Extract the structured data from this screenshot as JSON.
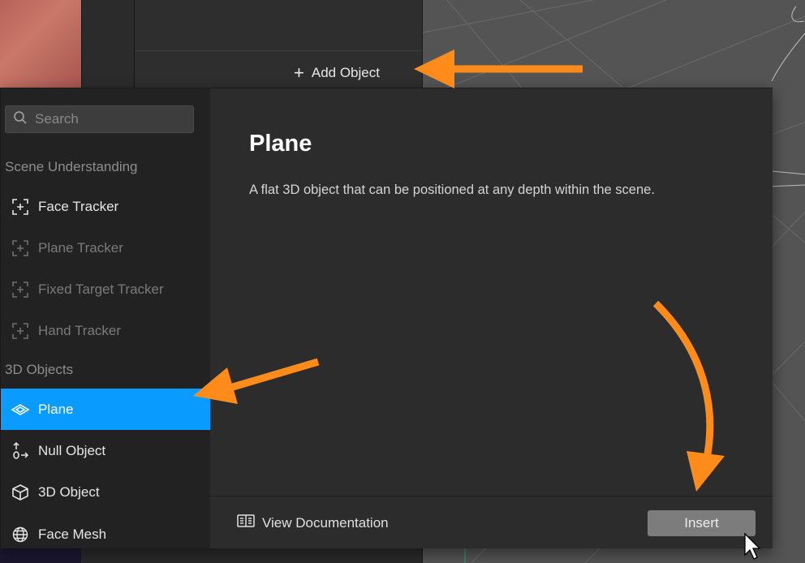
{
  "toolbar": {
    "add_object_label": "Add Object"
  },
  "dialog": {
    "search": {
      "placeholder": "Search"
    },
    "sections": [
      {
        "title": "Scene Understanding",
        "items": [
          {
            "label": "Face Tracker",
            "icon": "face-tracker-icon",
            "enabled": true
          },
          {
            "label": "Plane Tracker",
            "icon": "plane-tracker-icon",
            "enabled": false
          },
          {
            "label": "Fixed Target Tracker",
            "icon": "fixed-target-tracker-icon",
            "enabled": false
          },
          {
            "label": "Hand Tracker",
            "icon": "hand-tracker-icon",
            "enabled": false
          }
        ]
      },
      {
        "title": "3D Objects",
        "items": [
          {
            "label": "Plane",
            "icon": "plane-icon",
            "selected": true
          },
          {
            "label": "Null Object",
            "icon": "null-object-icon"
          },
          {
            "label": "3D Object",
            "icon": "cube-icon"
          },
          {
            "label": "Face Mesh",
            "icon": "face-mesh-icon"
          }
        ]
      }
    ],
    "detail": {
      "title": "Plane",
      "description": "A flat 3D object that can be positioned at any depth within the scene."
    },
    "footer": {
      "docs_label": "View Documentation",
      "insert_label": "Insert"
    }
  },
  "annotations": {
    "arrow_color": "#ff8c1a",
    "selection_color": "#0a9bff"
  }
}
